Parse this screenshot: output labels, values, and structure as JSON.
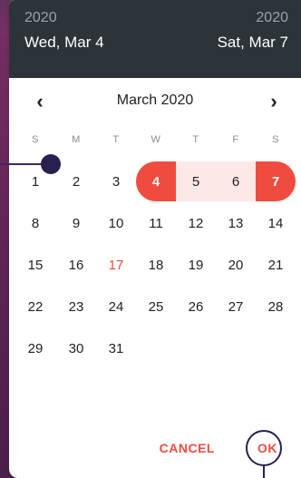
{
  "header": {
    "start_year": "2020",
    "end_year": "2020",
    "start_date": "Wed, Mar 4",
    "end_date": "Sat, Mar 7"
  },
  "nav": {
    "prev_icon": "‹",
    "next_icon": "›",
    "month_title": "March 2020"
  },
  "weekdays": [
    "S",
    "M",
    "T",
    "W",
    "T",
    "F",
    "S"
  ],
  "days": [
    [
      "1",
      "2",
      "3",
      "4",
      "5",
      "6",
      "7"
    ],
    [
      "8",
      "9",
      "10",
      "11",
      "12",
      "13",
      "14"
    ],
    [
      "15",
      "16",
      "17",
      "18",
      "19",
      "20",
      "21"
    ],
    [
      "22",
      "23",
      "24",
      "25",
      "26",
      "27",
      "28"
    ],
    [
      "29",
      "30",
      "31",
      "",
      "",
      "",
      ""
    ]
  ],
  "today": "17",
  "selection": {
    "start": "4",
    "end": "7"
  },
  "footer": {
    "cancel_label": "CANCEL",
    "ok_label": "OK"
  },
  "colors": {
    "accent": "#ef4c3f",
    "range": "#fde8e8",
    "header": "#2c3439"
  }
}
